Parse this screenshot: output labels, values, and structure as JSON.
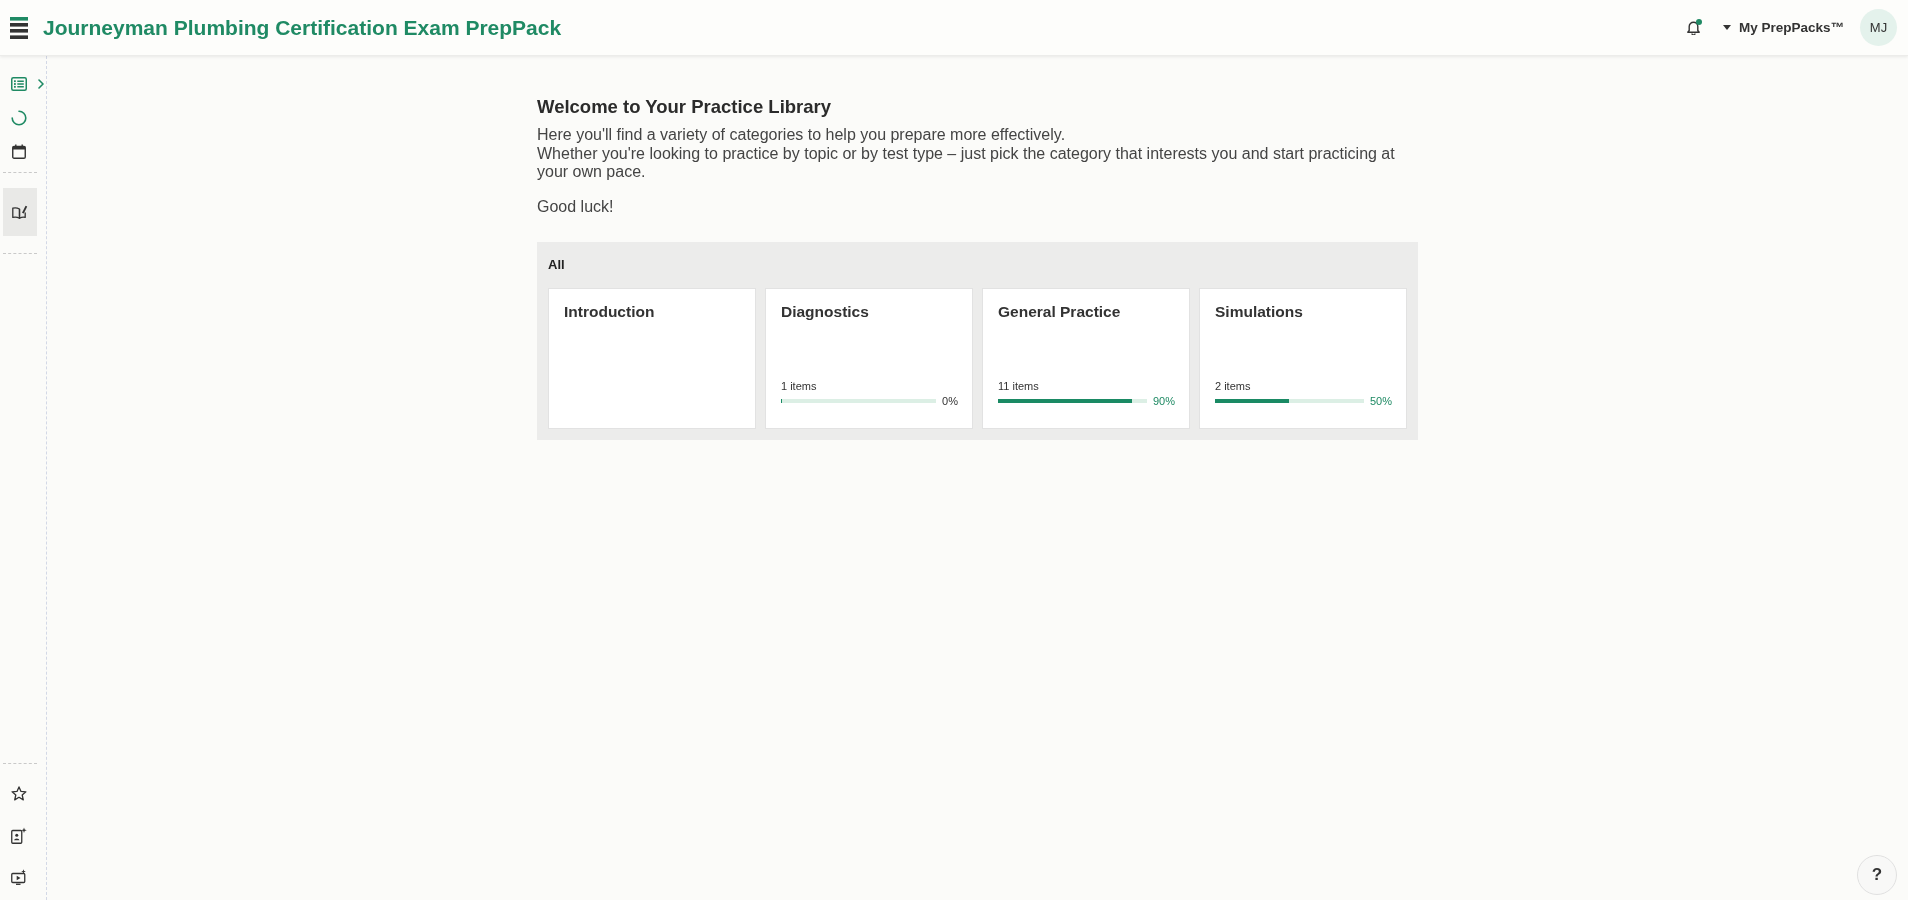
{
  "header": {
    "title": "Journeyman Plumbing Certification Exam PrepPack",
    "notifications": {
      "unread": true
    },
    "account_menu": {
      "label": "My PrepPacks™"
    },
    "avatar": {
      "initials": "MJ"
    }
  },
  "main": {
    "heading": "Welcome to Your Practice Library",
    "intro_lines": [
      "Here you'll find a variety of categories to help you prepare more effectively.",
      "Whether you're looking to practice by topic or by test type – just pick the category that interests you and start practicing at your own pace."
    ],
    "closing": "Good luck!",
    "group": {
      "title": "All",
      "cards": [
        {
          "kind": "intro",
          "title": "Introduction"
        },
        {
          "kind": "progress",
          "title": "Diagnostics",
          "count": "1 items",
          "level": 0,
          "percent": "0%"
        },
        {
          "kind": "progress",
          "title": "General Practice",
          "count": "11 items",
          "level": 0.9,
          "percent": "90%"
        },
        {
          "kind": "progress",
          "title": "Simulations",
          "count": "2 items",
          "level": 0.5,
          "percent": "50%"
        }
      ]
    }
  },
  "help_button": {
    "label": "?"
  }
}
